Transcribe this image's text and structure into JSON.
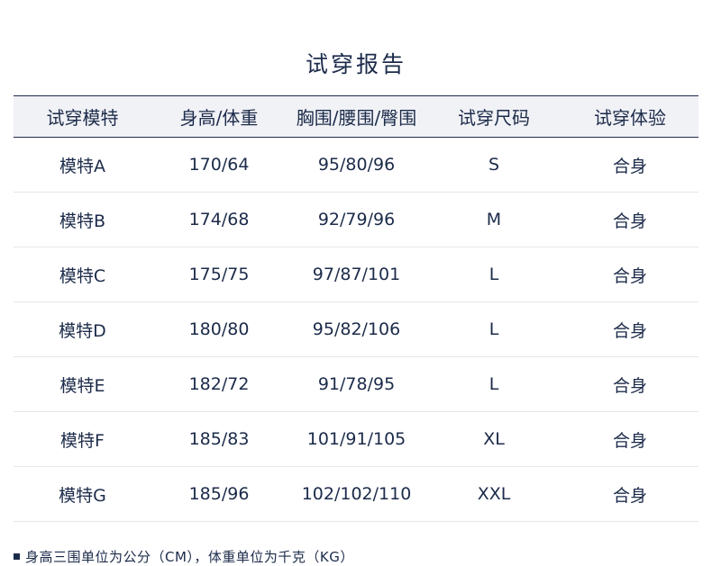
{
  "title": "试穿报告",
  "headers": [
    "试穿模特",
    "身高/体重",
    "胸围/腰围/臀围",
    "试穿尺码",
    "试穿体验"
  ],
  "rows": [
    [
      "模特A",
      "170/64",
      "95/80/96",
      "S",
      "合身"
    ],
    [
      "模特B",
      "174/68",
      "92/79/96",
      "M",
      "合身"
    ],
    [
      "模特C",
      "175/75",
      "97/87/101",
      "L",
      "合身"
    ],
    [
      "模特D",
      "180/80",
      "95/82/106",
      "L",
      "合身"
    ],
    [
      "模特E",
      "182/72",
      "91/78/95",
      "L",
      "合身"
    ],
    [
      "模特F",
      "185/83",
      "101/91/105",
      "XL",
      "合身"
    ],
    [
      "模特G",
      "185/96",
      "102/102/110",
      "XXL",
      "合身"
    ]
  ],
  "note": "身高三围单位为公分（CM），体重单位为千克（KG）"
}
